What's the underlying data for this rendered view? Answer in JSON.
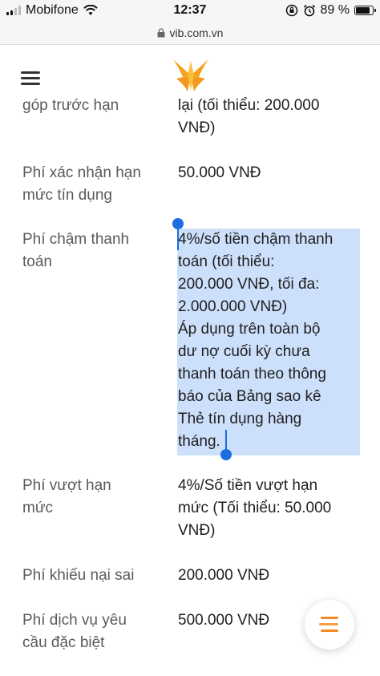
{
  "status_bar": {
    "carrier": "Mobifone",
    "time": "12:37",
    "battery_percent": "89 %",
    "battery_level": 0.89
  },
  "browser": {
    "url": "vib.com.vn"
  },
  "fees": [
    {
      "name": "góp trước hạn",
      "value": "lại (tối thiểu: 200.000\nVNĐ)"
    },
    {
      "name": "Phí xác nhận hạn\nmức tín dụng",
      "value": "50.000 VNĐ"
    },
    {
      "name": "Phí chậm thanh\ntoán",
      "value": "4%/số tiền chậm thanh\ntoán (tối thiểu:\n200.000 VNĐ, tối đa:\n2.000.000 VNĐ)\nÁp dụng trên toàn bộ\ndư nợ cuối kỳ chưa\nthanh toán theo thông\nbáo của Bảng sao kê\nThẻ tín dụng hàng\ntháng."
    },
    {
      "name": "Phí vượt hạn\nmức",
      "value": "4%/Số tiền vượt hạn\nmức (Tối thiểu: 50.000\nVNĐ)"
    },
    {
      "name": "Phí khiếu nại sai",
      "value": "200.000 VNĐ"
    },
    {
      "name": "Phí dịch vụ yêu\ncầu đặc biệt",
      "value": "500.000 VNĐ"
    }
  ],
  "colors": {
    "selection": "#cde0fb",
    "selection_handle": "#1b6de0",
    "logo_orange": "#f7a21b"
  }
}
